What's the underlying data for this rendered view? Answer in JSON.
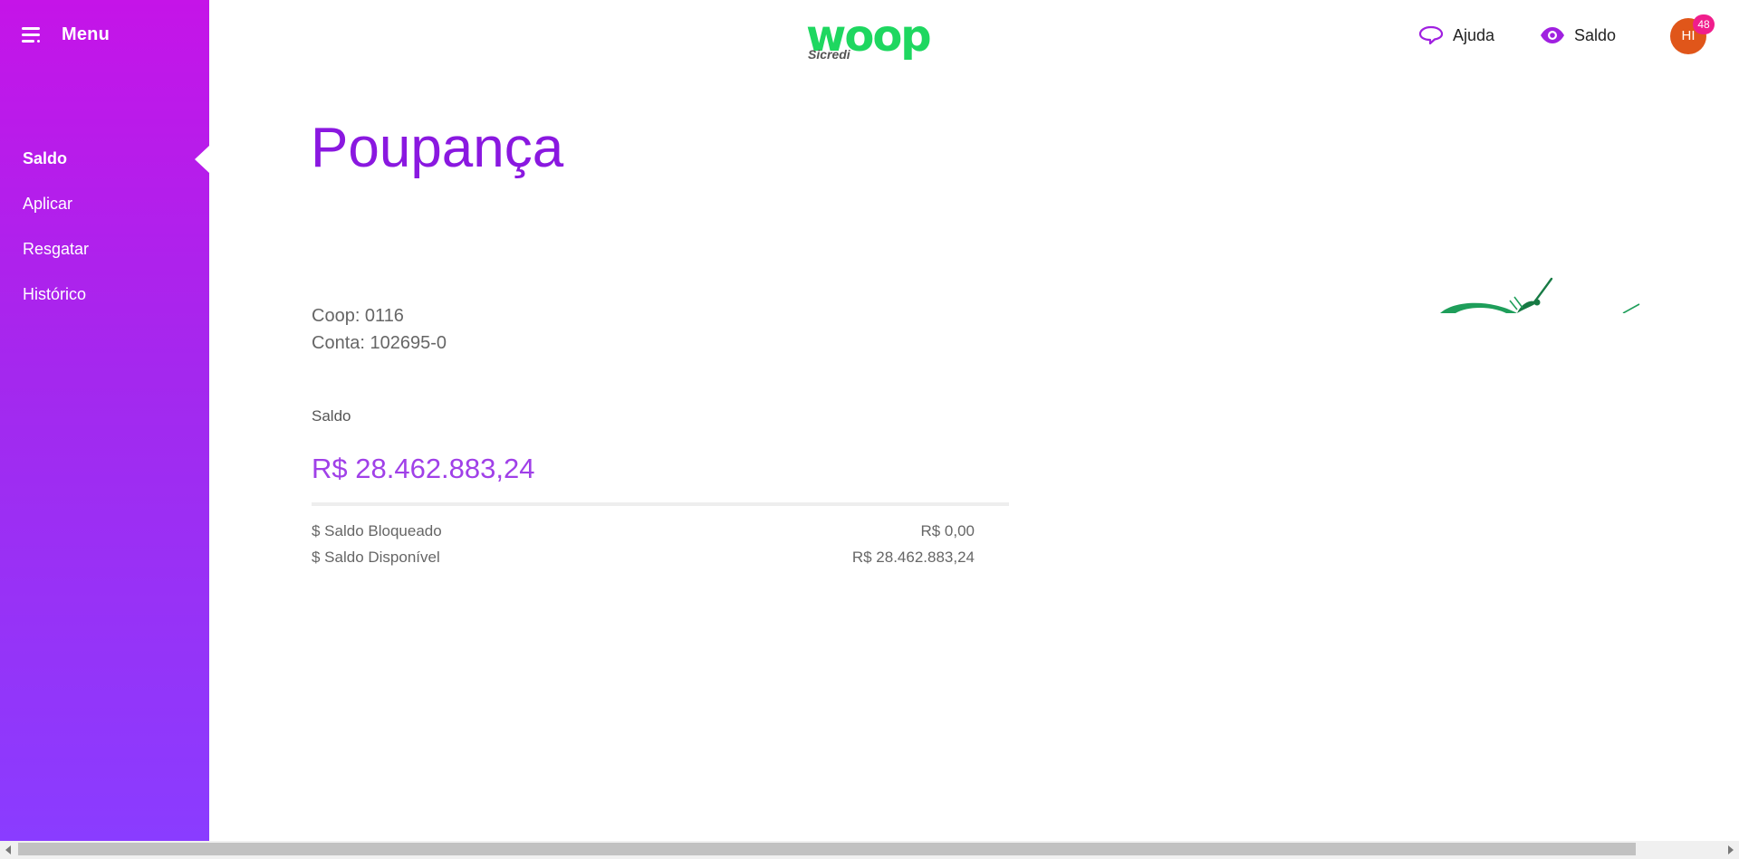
{
  "sidebar": {
    "menu_label": "Menu",
    "items": [
      {
        "label": "Saldo",
        "active": true
      },
      {
        "label": "Aplicar"
      },
      {
        "label": "Resgatar"
      },
      {
        "label": "Histórico"
      }
    ]
  },
  "header": {
    "logo": {
      "brand": "woop",
      "sub": "Sicredi"
    },
    "help_label": "Ajuda",
    "balance_toggle_label": "Saldo",
    "user_initials": "HI",
    "notifications_count": "48"
  },
  "main": {
    "title": "Poupança",
    "coop": "Coop: 0116",
    "account": "Conta: 102695-0",
    "balance_label": "Saldo",
    "balance_value": "R$ 28.462.883,24",
    "details": [
      {
        "label": "$ Saldo Bloqueado",
        "value": "R$ 0,00"
      },
      {
        "label": "$ Saldo Disponível",
        "value": "R$ 28.462.883,24"
      }
    ]
  },
  "colors": {
    "accent": "#8a18e0",
    "brand_green": "#1ed760",
    "sidebar_top": "#c514e8",
    "sidebar_bottom": "#8a3cff"
  },
  "icons": [
    "menu-icon",
    "chat-icon",
    "eye-icon"
  ]
}
